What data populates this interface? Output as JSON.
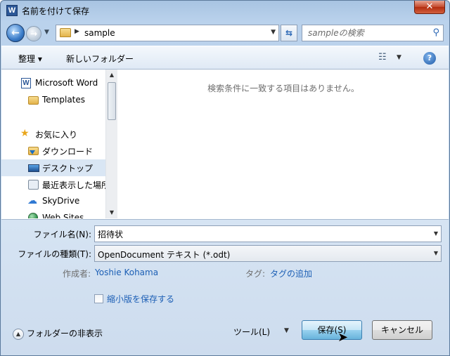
{
  "window": {
    "title": "名前を付けて保存",
    "icon_letter": "W",
    "close_symbol": "✕"
  },
  "nav": {
    "back_symbol": "←",
    "forward_symbol": "→",
    "address": "sample",
    "search_placeholder": "sampleの検索"
  },
  "toolbar": {
    "organize": "整理 ▾",
    "new_folder": "新しいフォルダー",
    "help": "?"
  },
  "sidebar": {
    "items": [
      {
        "label": "Microsoft Word",
        "icon": "word-icon"
      },
      {
        "label": "Templates",
        "icon": "folder-icon"
      },
      {
        "label": "お気に入り",
        "icon": "star-icon"
      },
      {
        "label": "ダウンロード",
        "icon": "download-folder-icon"
      },
      {
        "label": "デスクトップ",
        "icon": "desktop-icon",
        "selected": true
      },
      {
        "label": "最近表示した場所",
        "icon": "recent-places-icon"
      },
      {
        "label": "SkyDrive",
        "icon": "skydrive-icon"
      },
      {
        "label": "Web Sites",
        "icon": "web-sites-icon"
      }
    ]
  },
  "content": {
    "empty_message": "検索条件に一致する項目はありません。"
  },
  "form": {
    "filename_label": "ファイル名(N):",
    "filename_value": "招待状",
    "filetype_label": "ファイルの種類(T):",
    "filetype_value": "OpenDocument テキスト (*.odt)",
    "author_label": "作成者:",
    "author_value": "Yoshie Kohama",
    "tags_label": "タグ:",
    "tags_value": "タグの追加",
    "thumbnail_label": "縮小版を保存する",
    "thumbnail_checked": false
  },
  "footer": {
    "hide_folders": "フォルダーの非表示",
    "tools": "ツール(L)",
    "save": "保存(S)",
    "cancel": "キャンセル"
  }
}
